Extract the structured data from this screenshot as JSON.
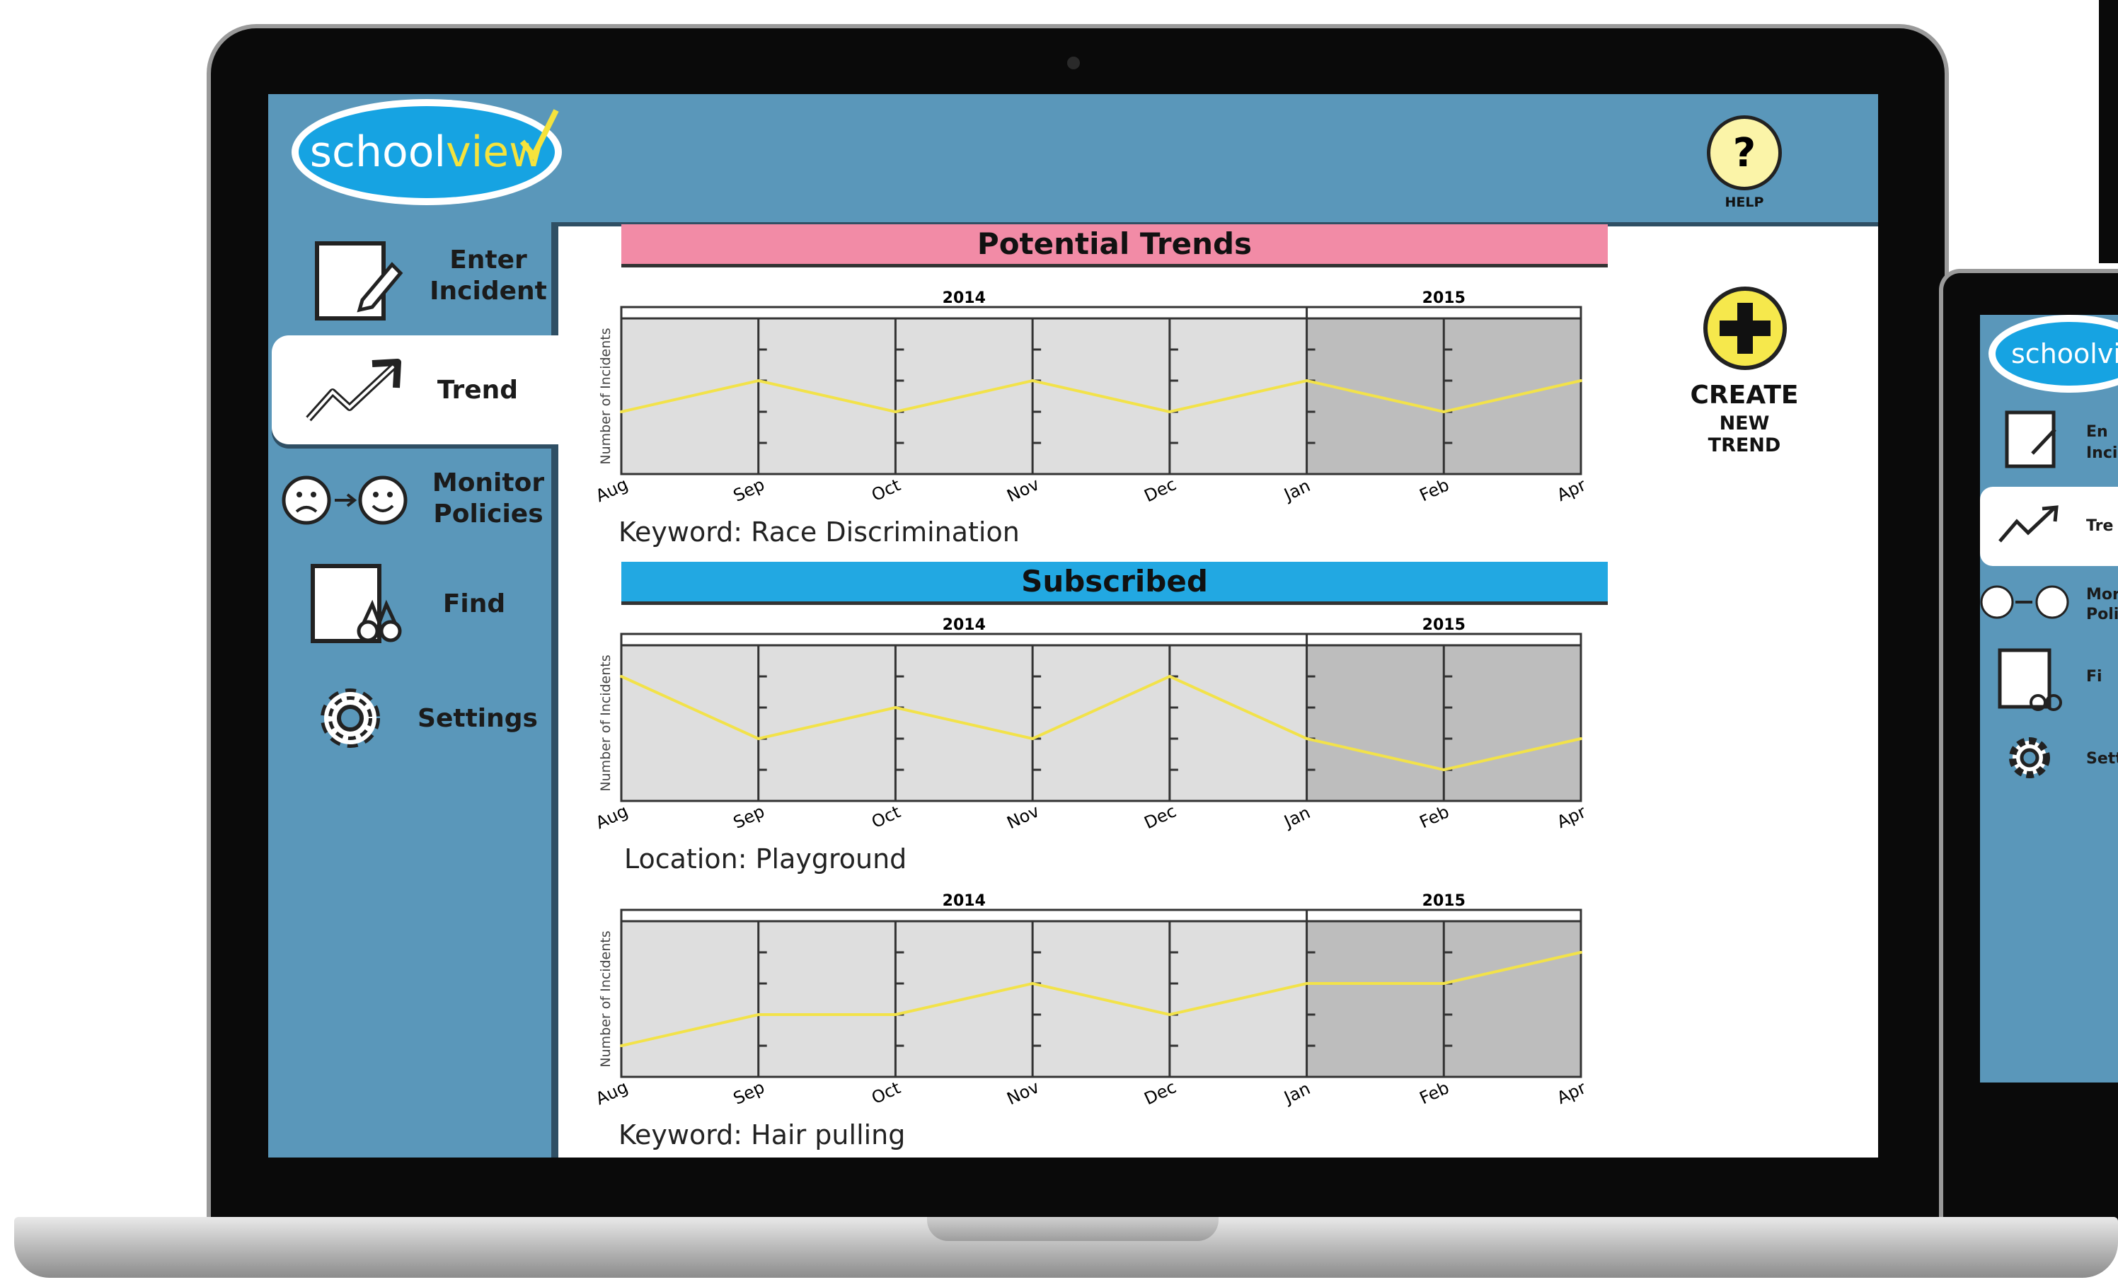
{
  "app": {
    "logo": {
      "school": "school",
      "view": "view"
    },
    "help_label": "HELP",
    "help_symbol": "?"
  },
  "sidebar": {
    "items": [
      {
        "label_lines": [
          "Enter",
          "Incident"
        ],
        "icon": "pencil-note-icon"
      },
      {
        "label_lines": [
          "Trend"
        ],
        "icon": "trend-arrow-icon",
        "active": true
      },
      {
        "label_lines": [
          "Monitor",
          "Policies"
        ],
        "icon": "sad-to-happy-icon"
      },
      {
        "label_lines": [
          "Find"
        ],
        "icon": "binoculars-icon"
      },
      {
        "label_lines": [
          "Settings"
        ],
        "icon": "gear-icon"
      }
    ]
  },
  "sections": {
    "potential": "Potential Trends",
    "subscribed": "Subscribed"
  },
  "create_button": {
    "line1": "CREATE",
    "line2": "NEW TREND"
  },
  "colors": {
    "screen_blue": "#5a97ba",
    "banner_pink": "#f28ba6",
    "banner_blue": "#22a8e2",
    "trend_line": "#f2e24a",
    "plot_light": "#dedede",
    "plot_dark": "#bdbdbd",
    "logo_blue": "#16a3e2",
    "help_yellow": "#fbf4a8",
    "create_yellow": "#f6e84c"
  },
  "chart_data": [
    {
      "type": "line",
      "years": [
        "2014",
        "2015"
      ],
      "categories": [
        "Aug",
        "Sep",
        "Oct",
        "Nov",
        "Dec",
        "Jan",
        "Feb",
        "Apr"
      ],
      "ylabel": "Number of Incidents",
      "ylim": [
        0,
        5
      ],
      "values": [
        2,
        3,
        2,
        3,
        2,
        3,
        2,
        3
      ],
      "caption": "Keyword: Race Discrimination"
    },
    {
      "type": "line",
      "years": [
        "2014",
        "2015"
      ],
      "categories": [
        "Aug",
        "Sep",
        "Oct",
        "Nov",
        "Dec",
        "Jan",
        "Feb",
        "Apr"
      ],
      "ylabel": "Number of Incidents",
      "ylim": [
        0,
        5
      ],
      "values": [
        4,
        2,
        3,
        2,
        4,
        2,
        1,
        2
      ],
      "caption": "Location: Playground"
    },
    {
      "type": "line",
      "years": [
        "2014",
        "2015"
      ],
      "categories": [
        "Aug",
        "Sep",
        "Oct",
        "Nov",
        "Dec",
        "Jan",
        "Feb",
        "Apr"
      ],
      "ylabel": "Number of Incidents",
      "ylim": [
        0,
        5
      ],
      "values": [
        1,
        2,
        2,
        3,
        2,
        3,
        3,
        4
      ],
      "caption": "Keyword: Hair pulling"
    }
  ],
  "second_device": {
    "logo": "schoolvi",
    "items": [
      "En",
      "Inci",
      "Tre",
      "Mor",
      "Poli",
      "Fi",
      "Sett"
    ]
  }
}
